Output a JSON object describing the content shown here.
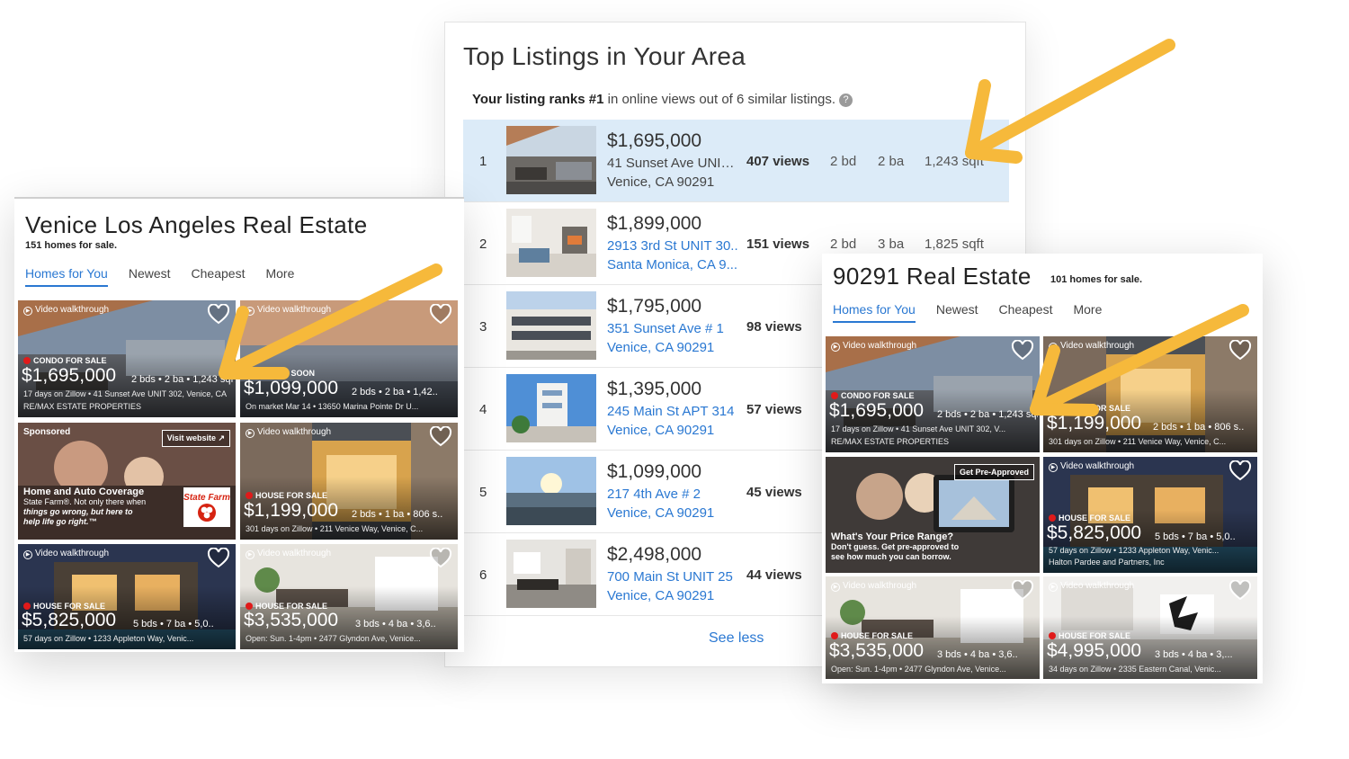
{
  "top_listings": {
    "title": "Top Listings in Your Area",
    "rank_prefix": "Your listing ranks ",
    "rank_bold": "#1",
    "rank_suffix": " in online views out of 6 similar listings.",
    "help_icon": "?",
    "rows": [
      {
        "rank": "1",
        "price": "$1,695,000",
        "addr1": "41 Sunset Ave UNIT 302",
        "addr2": "Venice, CA 90291",
        "views": "407 views",
        "bd": "2 bd",
        "ba": "2 ba",
        "sqft": "1,243 sqft"
      },
      {
        "rank": "2",
        "price": "$1,899,000",
        "addr1": "2913 3rd St UNIT 30..",
        "addr2": "Santa Monica, CA 9...",
        "views": "151 views",
        "bd": "2 bd",
        "ba": "3 ba",
        "sqft": "1,825 sqft"
      },
      {
        "rank": "3",
        "price": "$1,795,000",
        "addr1": "351 Sunset Ave # 1",
        "addr2": "Venice, CA 90291",
        "views": "98 views"
      },
      {
        "rank": "4",
        "price": "$1,395,000",
        "addr1": "245 Main St APT 314",
        "addr2": "Venice, CA 90291",
        "views": "57 views"
      },
      {
        "rank": "5",
        "price": "$1,099,000",
        "addr1": "217 4th Ave # 2",
        "addr2": "Venice, CA 90291",
        "views": "45 views"
      },
      {
        "rank": "6",
        "price": "$2,498,000",
        "addr1": "700 Main St UNIT 25",
        "addr2": "Venice, CA 90291",
        "views": "44 views"
      }
    ],
    "see_less": "See less"
  },
  "venice": {
    "title": "Venice Los Angeles Real Estate",
    "count": "151 homes for sale.",
    "tabs": [
      "Homes for You",
      "Newest",
      "Cheapest",
      "More"
    ],
    "cards": [
      {
        "video": "Video walkthrough",
        "status": "CONDO FOR SALE",
        "price": "$1,695,000",
        "facts": "2 bds • 2 ba • 1,243 sqft",
        "meta": "17 days on Zillow • 41 Sunset Ave UNIT 302, Venice, CA",
        "broker": "RE/MAX ESTATE PROPERTIES"
      },
      {
        "video": "Video walkthrough",
        "status": "COMING SOON",
        "price": "$1,099,000",
        "facts": "2 bds • 2 ba • 1,42..",
        "meta": "On market Mar 14 • 13650 Marina Pointe Dr U..."
      },
      {
        "sponsored": "Sponsored",
        "button": "Visit website ↗",
        "head": "Home and Auto Coverage",
        "line1": "State Farm®. Not only there when",
        "line2": "things go wrong, but here to",
        "line3": "help life go right.™",
        "logo": "State Farm"
      },
      {
        "video": "Video walkthrough",
        "status": "HOUSE FOR SALE",
        "price": "$1,199,000",
        "facts": "2 bds • 1 ba • 806 s..",
        "meta": "301 days on Zillow • 211 Venice Way, Venice, C..."
      },
      {
        "video": "Video walkthrough",
        "status": "HOUSE FOR SALE",
        "price": "$5,825,000",
        "facts": "5 bds • 7 ba • 5,0..",
        "meta": "57 days on Zillow • 1233 Appleton Way, Venic..."
      },
      {
        "video": "Video walkthrough",
        "status": "HOUSE FOR SALE",
        "price": "$3,535,000",
        "facts": "3 bds • 4 ba • 3,6..",
        "meta": "Open: Sun. 1-4pm • 2477 Glyndon Ave, Venice..."
      }
    ]
  },
  "zip": {
    "title": "90291 Real Estate",
    "count": "101 homes for sale.",
    "tabs": [
      "Homes for You",
      "Newest",
      "Cheapest",
      "More"
    ],
    "cards": [
      {
        "video": "Video walkthrough",
        "status": "CONDO FOR SALE",
        "price": "$1,695,000",
        "facts": "2 bds • 2 ba • 1,243 sqft",
        "meta": "17 days on Zillow • 41 Sunset Ave UNIT 302, V...",
        "broker": "RE/MAX ESTATE PROPERTIES"
      },
      {
        "video": "Video walkthrough",
        "status": "HOUSE FOR SALE",
        "price": "$1,199,000",
        "facts": "2 bds • 1 ba • 806 s..",
        "meta": "301 days on Zillow • 211 Venice Way, Venice, C..."
      },
      {
        "button": "Get Pre-Approved",
        "head": "What's Your Price Range?",
        "line1": "Don't guess. Get pre-approved to",
        "line2": "see how much you can borrow."
      },
      {
        "video": "Video walkthrough",
        "status": "HOUSE FOR SALE",
        "price": "$5,825,000",
        "facts": "5 bds • 7 ba • 5,0..",
        "meta": "57 days on Zillow • 1233 Appleton Way, Venic...",
        "broker": "Halton Pardee and Partners, Inc"
      },
      {
        "video": "Video walkthrough",
        "status": "HOUSE FOR SALE",
        "price": "$3,535,000",
        "facts": "3 bds • 4 ba • 3,6..",
        "meta": "Open: Sun. 1-4pm • 2477 Glyndon Ave, Venice..."
      },
      {
        "video": "Video walkthrough",
        "status": "HOUSE FOR SALE",
        "price": "$4,995,000",
        "facts": "3 bds • 4 ba • 3,...",
        "meta": "34 days on Zillow • 2335 Eastern Canal, Venic..."
      }
    ]
  },
  "colors": {
    "accent_link": "#2a78d2",
    "highlight_row": "#dcebf8",
    "arrow": "#f6b93b",
    "status_dot": "#e01a1a"
  }
}
